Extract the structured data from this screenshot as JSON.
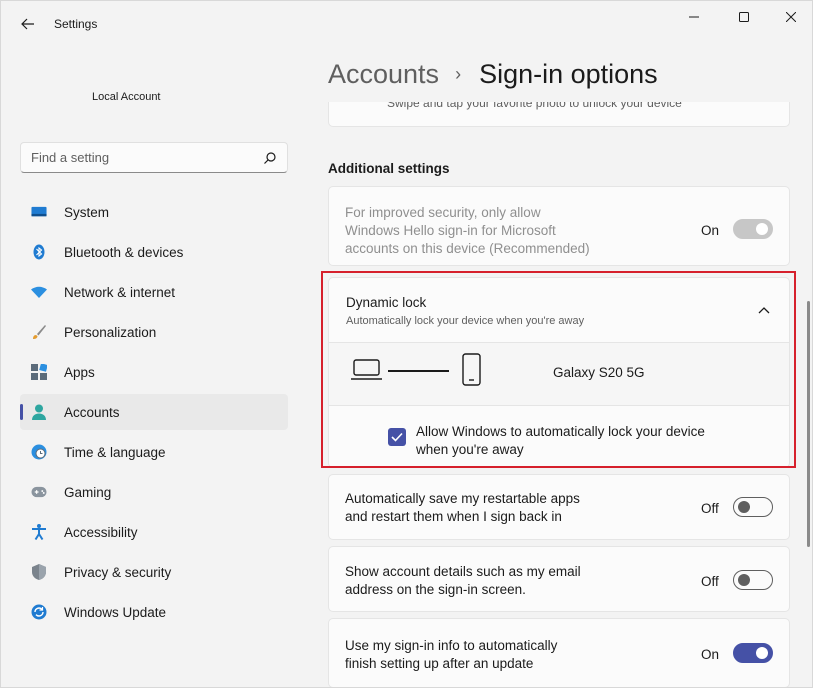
{
  "window": {
    "title": "Settings",
    "controls": {
      "minimize": "minimize-icon",
      "maximize": "maximize-icon",
      "close": "close-icon"
    }
  },
  "profile": {
    "name": "Local Account"
  },
  "search": {
    "placeholder": "Find a setting",
    "value": ""
  },
  "sidebar": {
    "items": [
      {
        "label": "System",
        "icon": "system-icon"
      },
      {
        "label": "Bluetooth & devices",
        "icon": "bluetooth-icon"
      },
      {
        "label": "Network & internet",
        "icon": "wifi-icon"
      },
      {
        "label": "Personalization",
        "icon": "brush-icon"
      },
      {
        "label": "Apps",
        "icon": "apps-icon"
      },
      {
        "label": "Accounts",
        "icon": "account-icon",
        "active": true
      },
      {
        "label": "Time & language",
        "icon": "globe-clock-icon"
      },
      {
        "label": "Gaming",
        "icon": "gamepad-icon"
      },
      {
        "label": "Accessibility",
        "icon": "accessibility-icon"
      },
      {
        "label": "Privacy & security",
        "icon": "shield-icon"
      },
      {
        "label": "Windows Update",
        "icon": "update-icon"
      }
    ]
  },
  "breadcrumb": {
    "parent": "Accounts",
    "separator": "›",
    "current": "Sign-in options"
  },
  "top_card": {
    "text": "Swipe and tap your favorite photo to unlock your device"
  },
  "additional_settings": {
    "title": "Additional settings",
    "hello_only": {
      "text_line1": "For improved security, only allow",
      "text_line2": "Windows Hello sign-in for Microsoft",
      "text_line3": "accounts on this device (Recommended)",
      "state": "On",
      "enabled": false
    },
    "dynamic_lock": {
      "title": "Dynamic lock",
      "subtitle": "Automatically lock your device when you're away",
      "device_name": "Galaxy S20 5G",
      "checkbox_line1": "Allow Windows to automatically lock your device",
      "checkbox_line2": "when you're away",
      "checked": true
    },
    "restart_apps": {
      "text_line1": "Automatically save my restartable apps",
      "text_line2": "and restart them when I sign back in",
      "state": "Off"
    },
    "account_details": {
      "text_line1": "Show account details such as my email",
      "text_line2": "address on the sign-in screen.",
      "state": "Off"
    },
    "signin_info": {
      "text_line1": "Use my sign-in info to automatically",
      "text_line2": "finish setting up after an update",
      "state": "On"
    }
  },
  "colors": {
    "accent": "#4551a6",
    "highlight": "#d6202c",
    "background": "#f3f3f3",
    "card": "#fbfbfb"
  }
}
